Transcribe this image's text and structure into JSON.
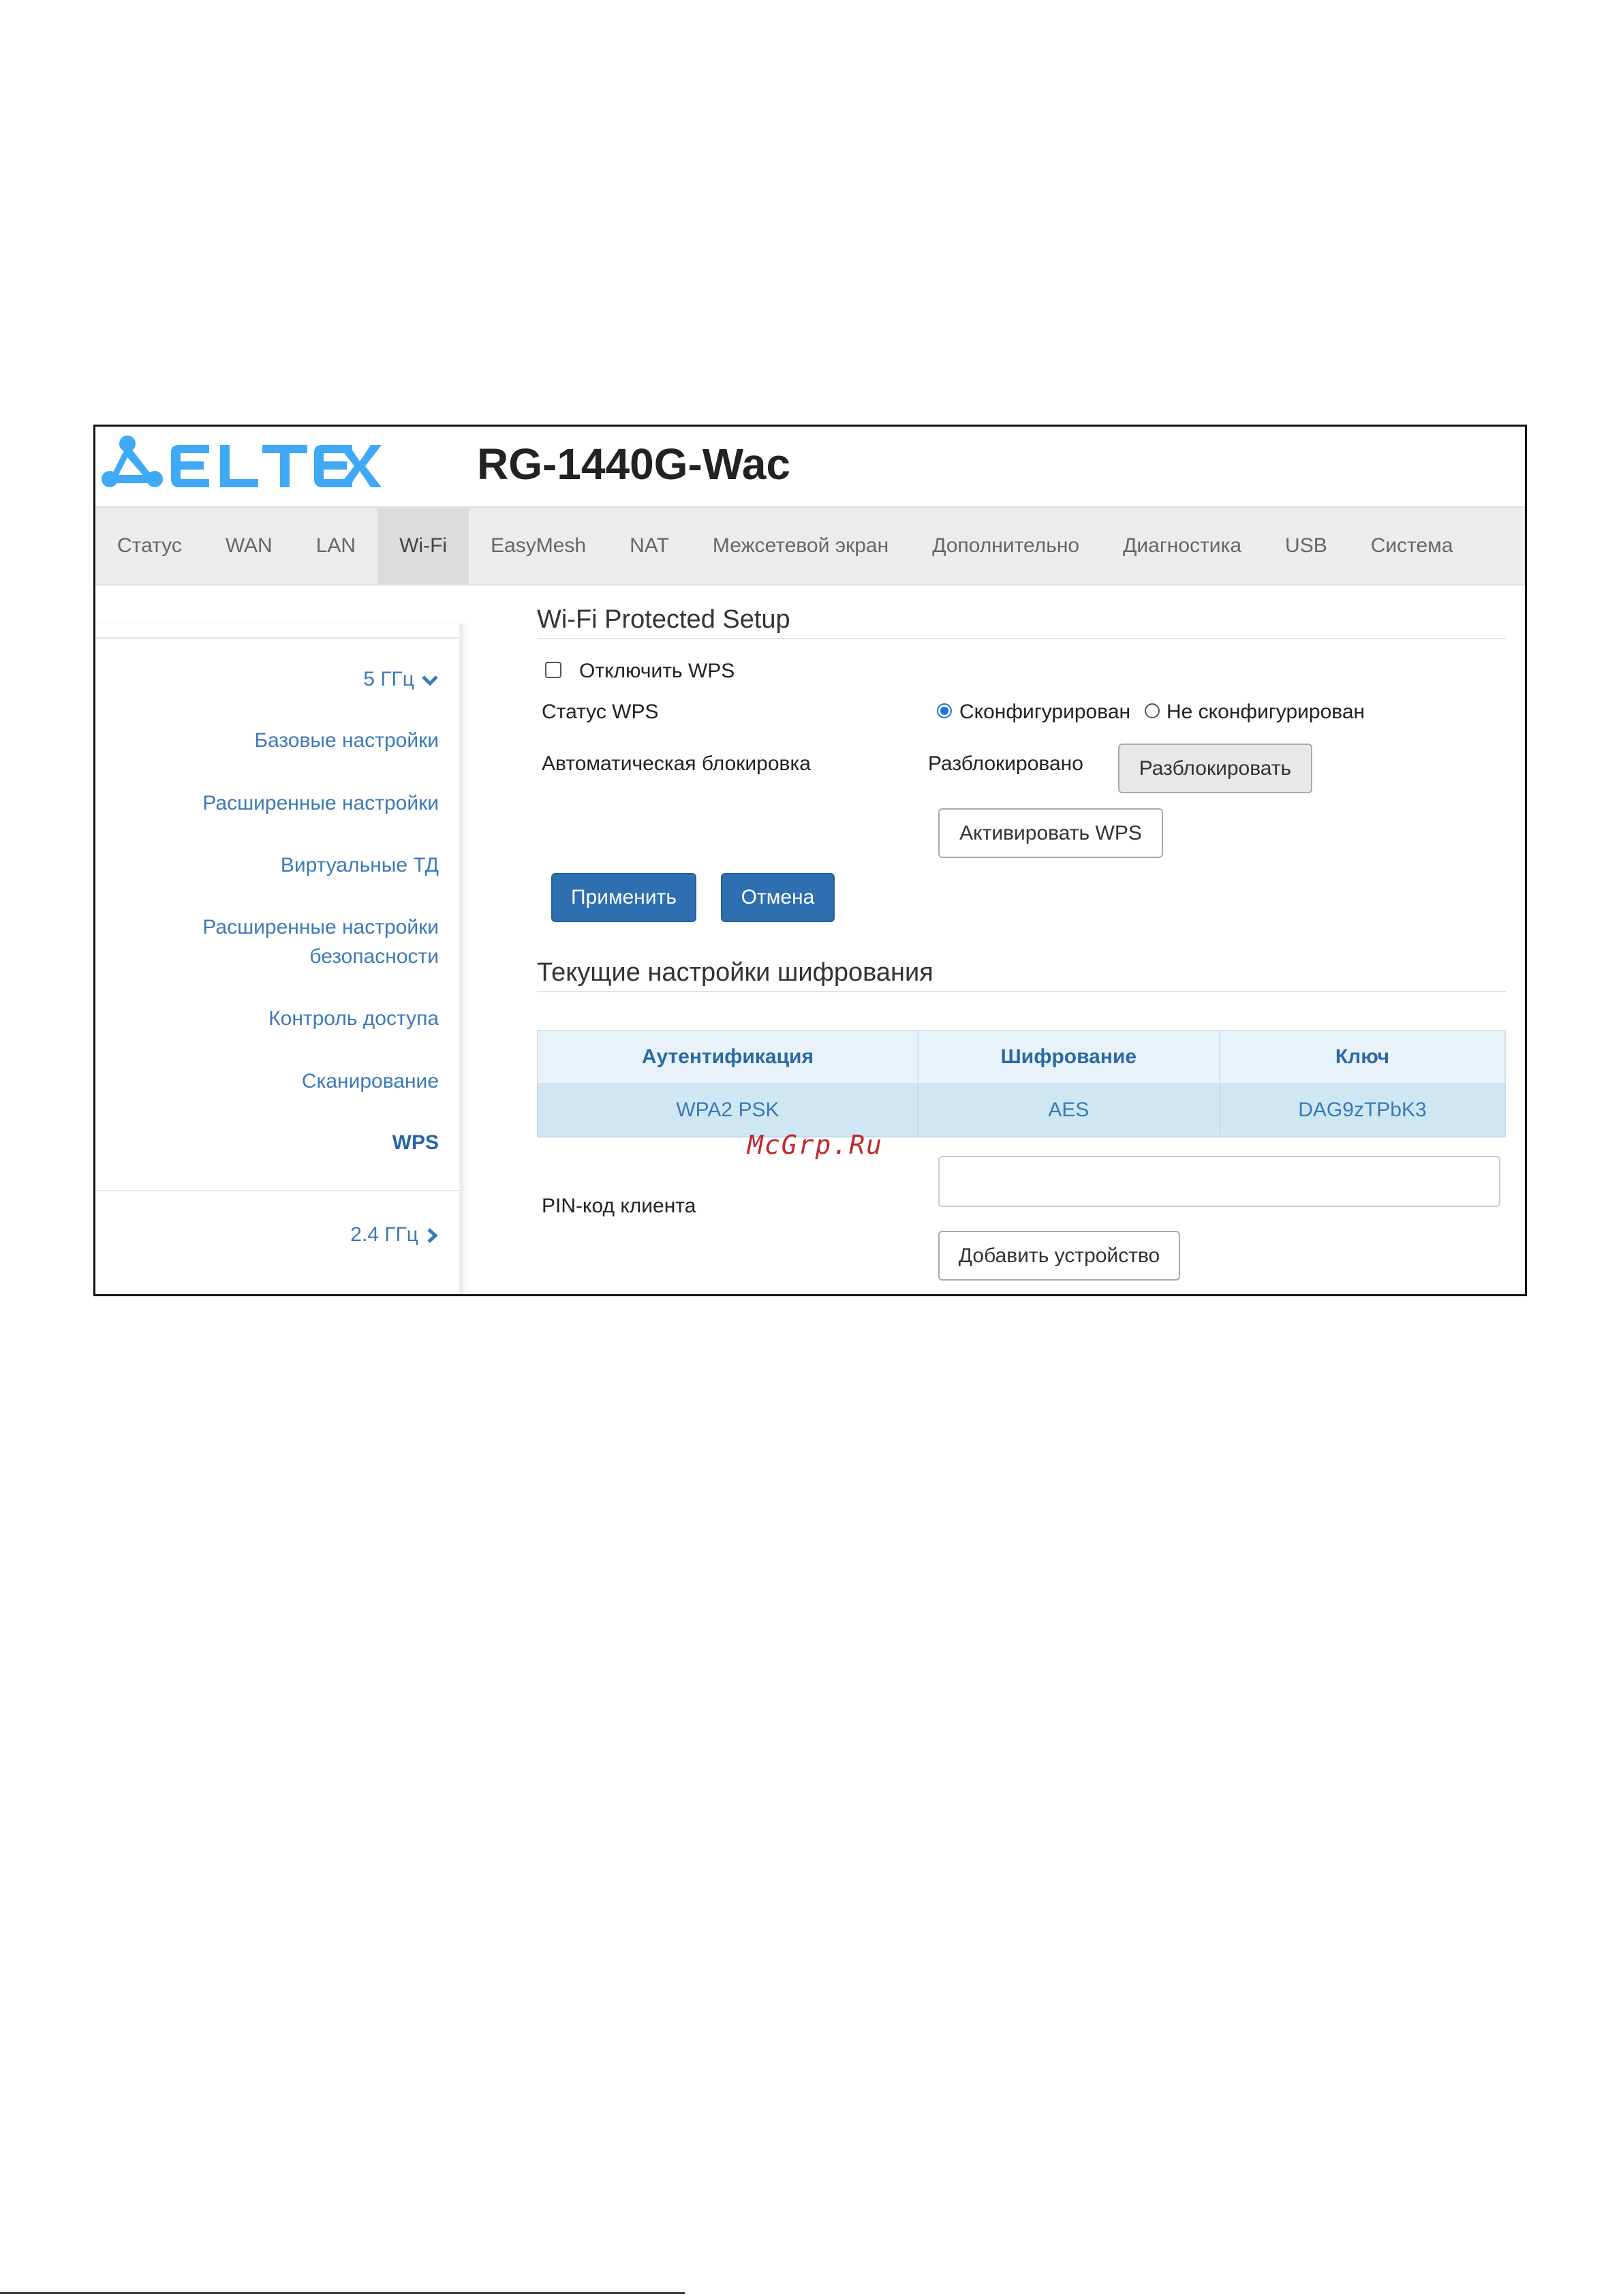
{
  "brand": {
    "logo_text": "ELTEX",
    "model": "RG-1440G-Wac",
    "logo_color": "#3fa9f5"
  },
  "nav": {
    "items": [
      "Статус",
      "WAN",
      "LAN",
      "Wi-Fi",
      "EasyMesh",
      "NAT",
      "Межсетевой экран",
      "Дополнительно",
      "Диагностика",
      "USB",
      "Система"
    ],
    "active": "Wi-Fi"
  },
  "sidebar": {
    "band_5": "5 ГГц",
    "items": [
      "Базовые настройки",
      "Расширенные настройки",
      "Виртуальные ТД",
      "Расширенные настройки",
      "безопасности",
      "Контроль доступа",
      "Сканирование",
      "WPS"
    ],
    "band_24": "2.4 ГГц",
    "active": "WPS"
  },
  "wps": {
    "title": "Wi-Fi Protected Setup",
    "disable_label": "Отключить WPS",
    "disable_checked": false,
    "status_label": "Статус WPS",
    "status_option_configured": "Сконфигурирован",
    "status_option_not_configured": "Не сконфигурирован",
    "status_selected": "Сконфигурирован",
    "autolock_label": "Автоматическая блокировка",
    "autolock_value": "Разблокировано",
    "unlock_button": "Разблокировать",
    "activate_button": "Активировать WPS",
    "apply_button": "Применить",
    "cancel_button": "Отмена"
  },
  "encryption": {
    "title": "Текущие настройки шифрования",
    "headers": [
      "Аутентификация",
      "Шифрование",
      "Ключ"
    ],
    "rows": [
      [
        "WPA2 PSK",
        "AES",
        "DAG9zTPbK3"
      ]
    ]
  },
  "pin": {
    "label": "PIN-код клиента",
    "value": "",
    "add_button": "Добавить устройство"
  },
  "watermark": "McGrp.Ru",
  "colors": {
    "primary": "#2d6fb0",
    "link": "#3a7ab8",
    "nav_bg": "#ececec",
    "table_row": "#cfe6f3"
  }
}
